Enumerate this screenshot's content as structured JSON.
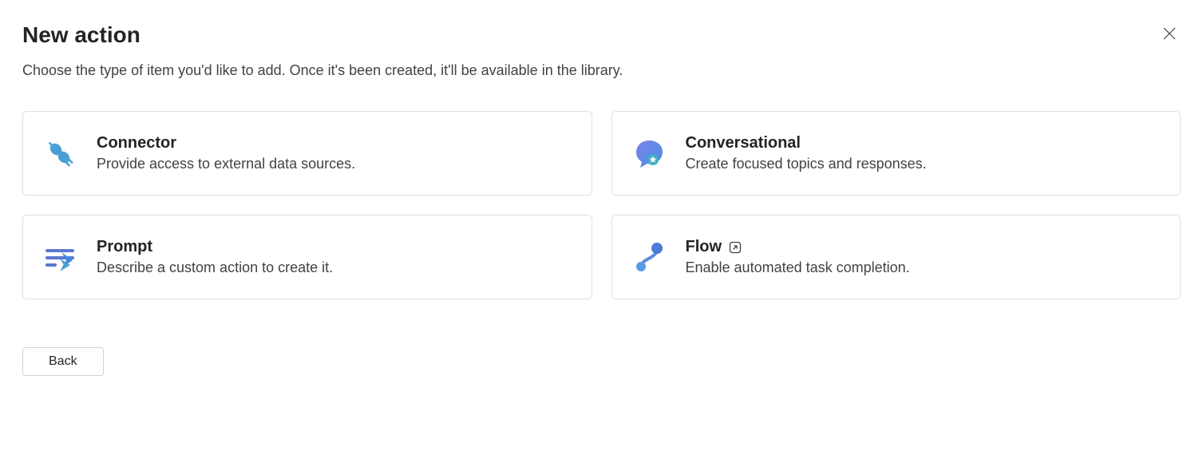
{
  "header": {
    "title": "New action",
    "subtitle": "Choose the type of item you'd like to add. Once it's been created, it'll be available in the library."
  },
  "cards": {
    "connector": {
      "title": "Connector",
      "desc": "Provide access to external data sources."
    },
    "conversational": {
      "title": "Conversational",
      "desc": "Create focused topics and responses."
    },
    "prompt": {
      "title": "Prompt",
      "desc": "Describe a custom action to create it."
    },
    "flow": {
      "title": "Flow",
      "desc": "Enable automated task completion."
    }
  },
  "footer": {
    "back_label": "Back"
  }
}
